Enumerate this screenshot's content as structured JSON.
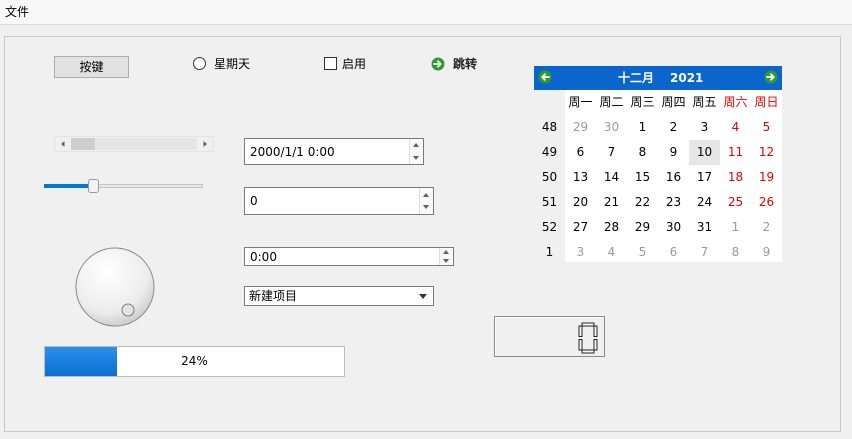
{
  "menubar": {
    "items": [
      {
        "label": "文件"
      }
    ]
  },
  "push_button": {
    "label": "按键"
  },
  "radio": {
    "label": "星期天",
    "checked": false
  },
  "checkbox": {
    "label": "启用",
    "checked": false
  },
  "command_link": {
    "label": "跳转",
    "icon": "green-arrow-right-icon"
  },
  "scrollbar": {
    "value_fraction": 0.0
  },
  "slider": {
    "value_fraction": 0.3
  },
  "datetime_edit": {
    "value": "2000/1/1 0:00"
  },
  "spin_box": {
    "value": "0"
  },
  "time_edit": {
    "value": "0:00"
  },
  "combo_box": {
    "selected": "新建项目"
  },
  "dial": {
    "value_fraction": 0.6
  },
  "progress_bar": {
    "value": 24,
    "text": "24%",
    "color": "#0a6fd0"
  },
  "lcd_number": {
    "value": "0"
  },
  "calendar": {
    "month": "十二月",
    "year": "2021",
    "header_color": "#0a66cc",
    "weekend_color": "#e00000",
    "weekdays": [
      "周一",
      "周二",
      "周三",
      "周四",
      "周五",
      "周六",
      "周日"
    ],
    "weeks": [
      {
        "week": "48",
        "days": [
          "29",
          "30",
          "1",
          "2",
          "3",
          "4",
          "5"
        ]
      },
      {
        "week": "49",
        "days": [
          "6",
          "7",
          "8",
          "9",
          "10",
          "11",
          "12"
        ]
      },
      {
        "week": "50",
        "days": [
          "13",
          "14",
          "15",
          "16",
          "17",
          "18",
          "19"
        ]
      },
      {
        "week": "51",
        "days": [
          "20",
          "21",
          "22",
          "23",
          "24",
          "25",
          "26"
        ]
      },
      {
        "week": "52",
        "days": [
          "27",
          "28",
          "29",
          "30",
          "31",
          "1",
          "2"
        ]
      },
      {
        "week": "1",
        "days": [
          "3",
          "4",
          "5",
          "6",
          "7",
          "8",
          "9"
        ]
      }
    ],
    "selected_day": "10"
  }
}
